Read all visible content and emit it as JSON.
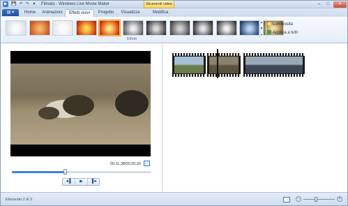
{
  "window": {
    "title": "Filmato - Windows Live Movie Maker",
    "context_tab_label": "Strumenti video",
    "minimize": "–",
    "maximize": "□",
    "close": "✕"
  },
  "quick_access": {
    "app_icon": "movie-maker-logo",
    "save_icon": "💾",
    "undo_icon": "↶",
    "redo_icon": "↷",
    "menu_icon": "▾"
  },
  "tabs": {
    "file_button_icon": "▤ ▾",
    "items": [
      {
        "id": "home",
        "label": "Home"
      },
      {
        "id": "animazioni",
        "label": "Animazioni"
      },
      {
        "id": "effetti",
        "label": "Effetti visivi",
        "active": true
      },
      {
        "id": "progetto",
        "label": "Progetto"
      },
      {
        "id": "visualizza",
        "label": "Visualizza"
      },
      {
        "id": "modifica",
        "label": "Modifica"
      }
    ]
  },
  "ribbon": {
    "group_label": "Effetti",
    "luminosita_label": "Luminosità",
    "apply_all_label": "Applica a tutti",
    "gallery_up": "▲",
    "gallery_down": "▼",
    "gallery_more": "▾",
    "effects": [
      {
        "name": "none",
        "colors": [
          "#ffffff",
          "#d7dde6"
        ]
      },
      {
        "name": "blur-orange",
        "colors": [
          "#f5b36a",
          "#c84f1c"
        ]
      },
      {
        "name": "outline",
        "colors": [
          "#ffffff",
          "#e6e6e6"
        ]
      },
      {
        "name": "edges-fire",
        "colors": [
          "#ffd34d",
          "#c62a08"
        ]
      },
      {
        "name": "fire-selected",
        "colors": [
          "#ffe27a",
          "#d2240a"
        ],
        "selected": true
      },
      {
        "name": "bw-1",
        "colors": [
          "#eeeeee",
          "#5a5a5a"
        ]
      },
      {
        "name": "bw-2",
        "colors": [
          "#d9d9d9",
          "#333333"
        ]
      },
      {
        "name": "bw-3",
        "colors": [
          "#cfcfcf",
          "#444444"
        ]
      },
      {
        "name": "bw-4",
        "colors": [
          "#e5e5e5",
          "#2e2e2e"
        ]
      },
      {
        "name": "bw-5",
        "colors": [
          "#f0f0f0",
          "#3a3a3a"
        ]
      },
      {
        "name": "cyan",
        "colors": [
          "#b7d2f0",
          "#1f3a66"
        ]
      },
      {
        "name": "sepia",
        "colors": [
          "#f0d9a9",
          "#8a6a2f"
        ]
      }
    ]
  },
  "preview": {
    "time_display": "00:11,38/00:30,00",
    "progress": 0.38,
    "prev_frame_icon": "◄▌",
    "play_icon": "▶",
    "next_frame_icon": "▐►"
  },
  "storyboard": {
    "playhead_fraction": 0.35,
    "clips": [
      {
        "name": "clip-1",
        "colors": [
          "#a8bfd6",
          "#6b7d4a"
        ]
      },
      {
        "name": "clip-2",
        "colors": [
          "#8b8069",
          "#5c533f"
        ],
        "selected": true
      },
      {
        "name": "clip-3",
        "colors": [
          "#9aa7b6",
          "#3d4654"
        ]
      }
    ]
  },
  "status": {
    "text": "Elemento 2 di 3",
    "zoom_out": "−",
    "zoom_in": "+",
    "zoom_level": 0.4
  }
}
